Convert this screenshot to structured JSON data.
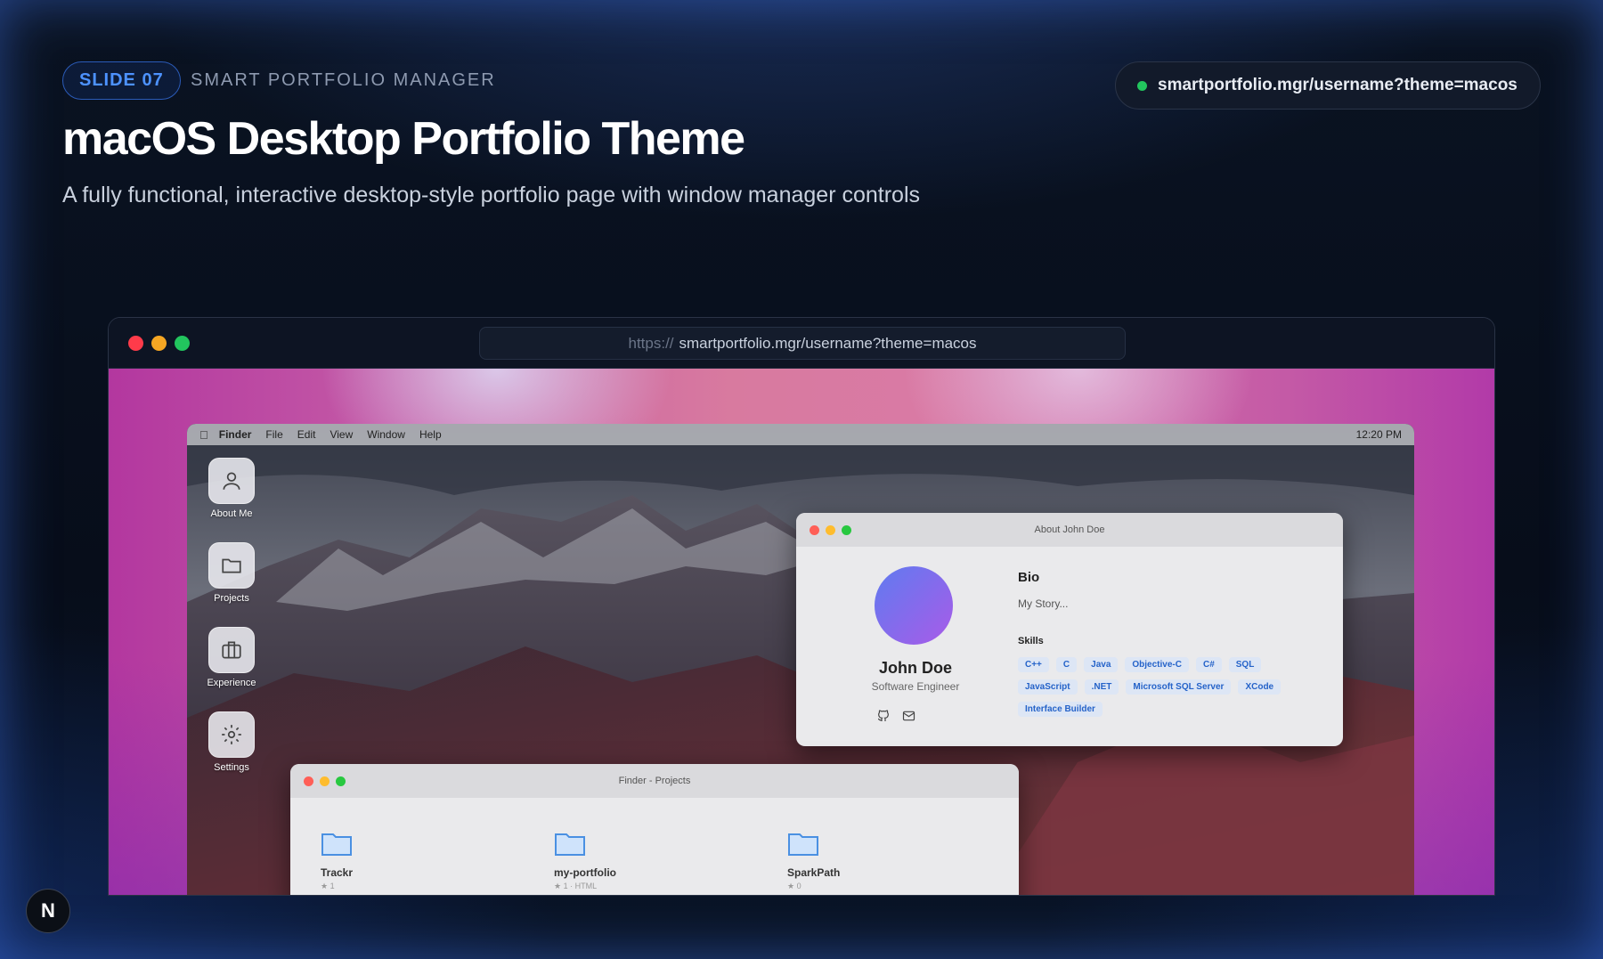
{
  "header": {
    "slide_tag": "SLIDE 07",
    "subtitle": "SMART PORTFOLIO MANAGER",
    "title": "macOS Desktop Portfolio Theme",
    "description": "A fully functional, interactive desktop-style portfolio page with window manager controls",
    "url": "smartportfolio.mgr/username?theme=macos"
  },
  "browser": {
    "scheme": "https://",
    "address": "smartportfolio.mgr/username?theme=macos"
  },
  "menubar": {
    "app": "Finder",
    "items": [
      "File",
      "Edit",
      "View",
      "Window",
      "Help"
    ],
    "clock": "12:20 PM"
  },
  "dock": [
    {
      "label": "About Me",
      "icon": "user-icon"
    },
    {
      "label": "Projects",
      "icon": "folder-icon"
    },
    {
      "label": "Experience",
      "icon": "briefcase-icon"
    },
    {
      "label": "Settings",
      "icon": "gear-icon"
    }
  ],
  "about_window": {
    "title": "About John Doe",
    "name": "John Doe",
    "role": "Software Engineer",
    "bio_heading": "Bio",
    "bio_text": "My Story...",
    "skills_heading": "Skills",
    "skills": [
      "C++",
      "C",
      "Java",
      "Objective-C",
      "C#",
      "SQL",
      "JavaScript",
      ".NET",
      "Microsoft SQL Server",
      "XCode",
      "Interface Builder"
    ]
  },
  "finder_window": {
    "title": "Finder - Projects",
    "folders": [
      {
        "name": "Trackr",
        "meta": "★ 1"
      },
      {
        "name": "my-portfolio",
        "meta": "★ 1 · HTML"
      },
      {
        "name": "SparkPath",
        "meta": "★ 0"
      }
    ]
  },
  "badge": "N",
  "colors": {
    "accent": "#4d92ff",
    "status_online": "#22c55e",
    "traffic_red": "#ff5f57",
    "traffic_yellow": "#febc2e",
    "traffic_green": "#28c840"
  }
}
